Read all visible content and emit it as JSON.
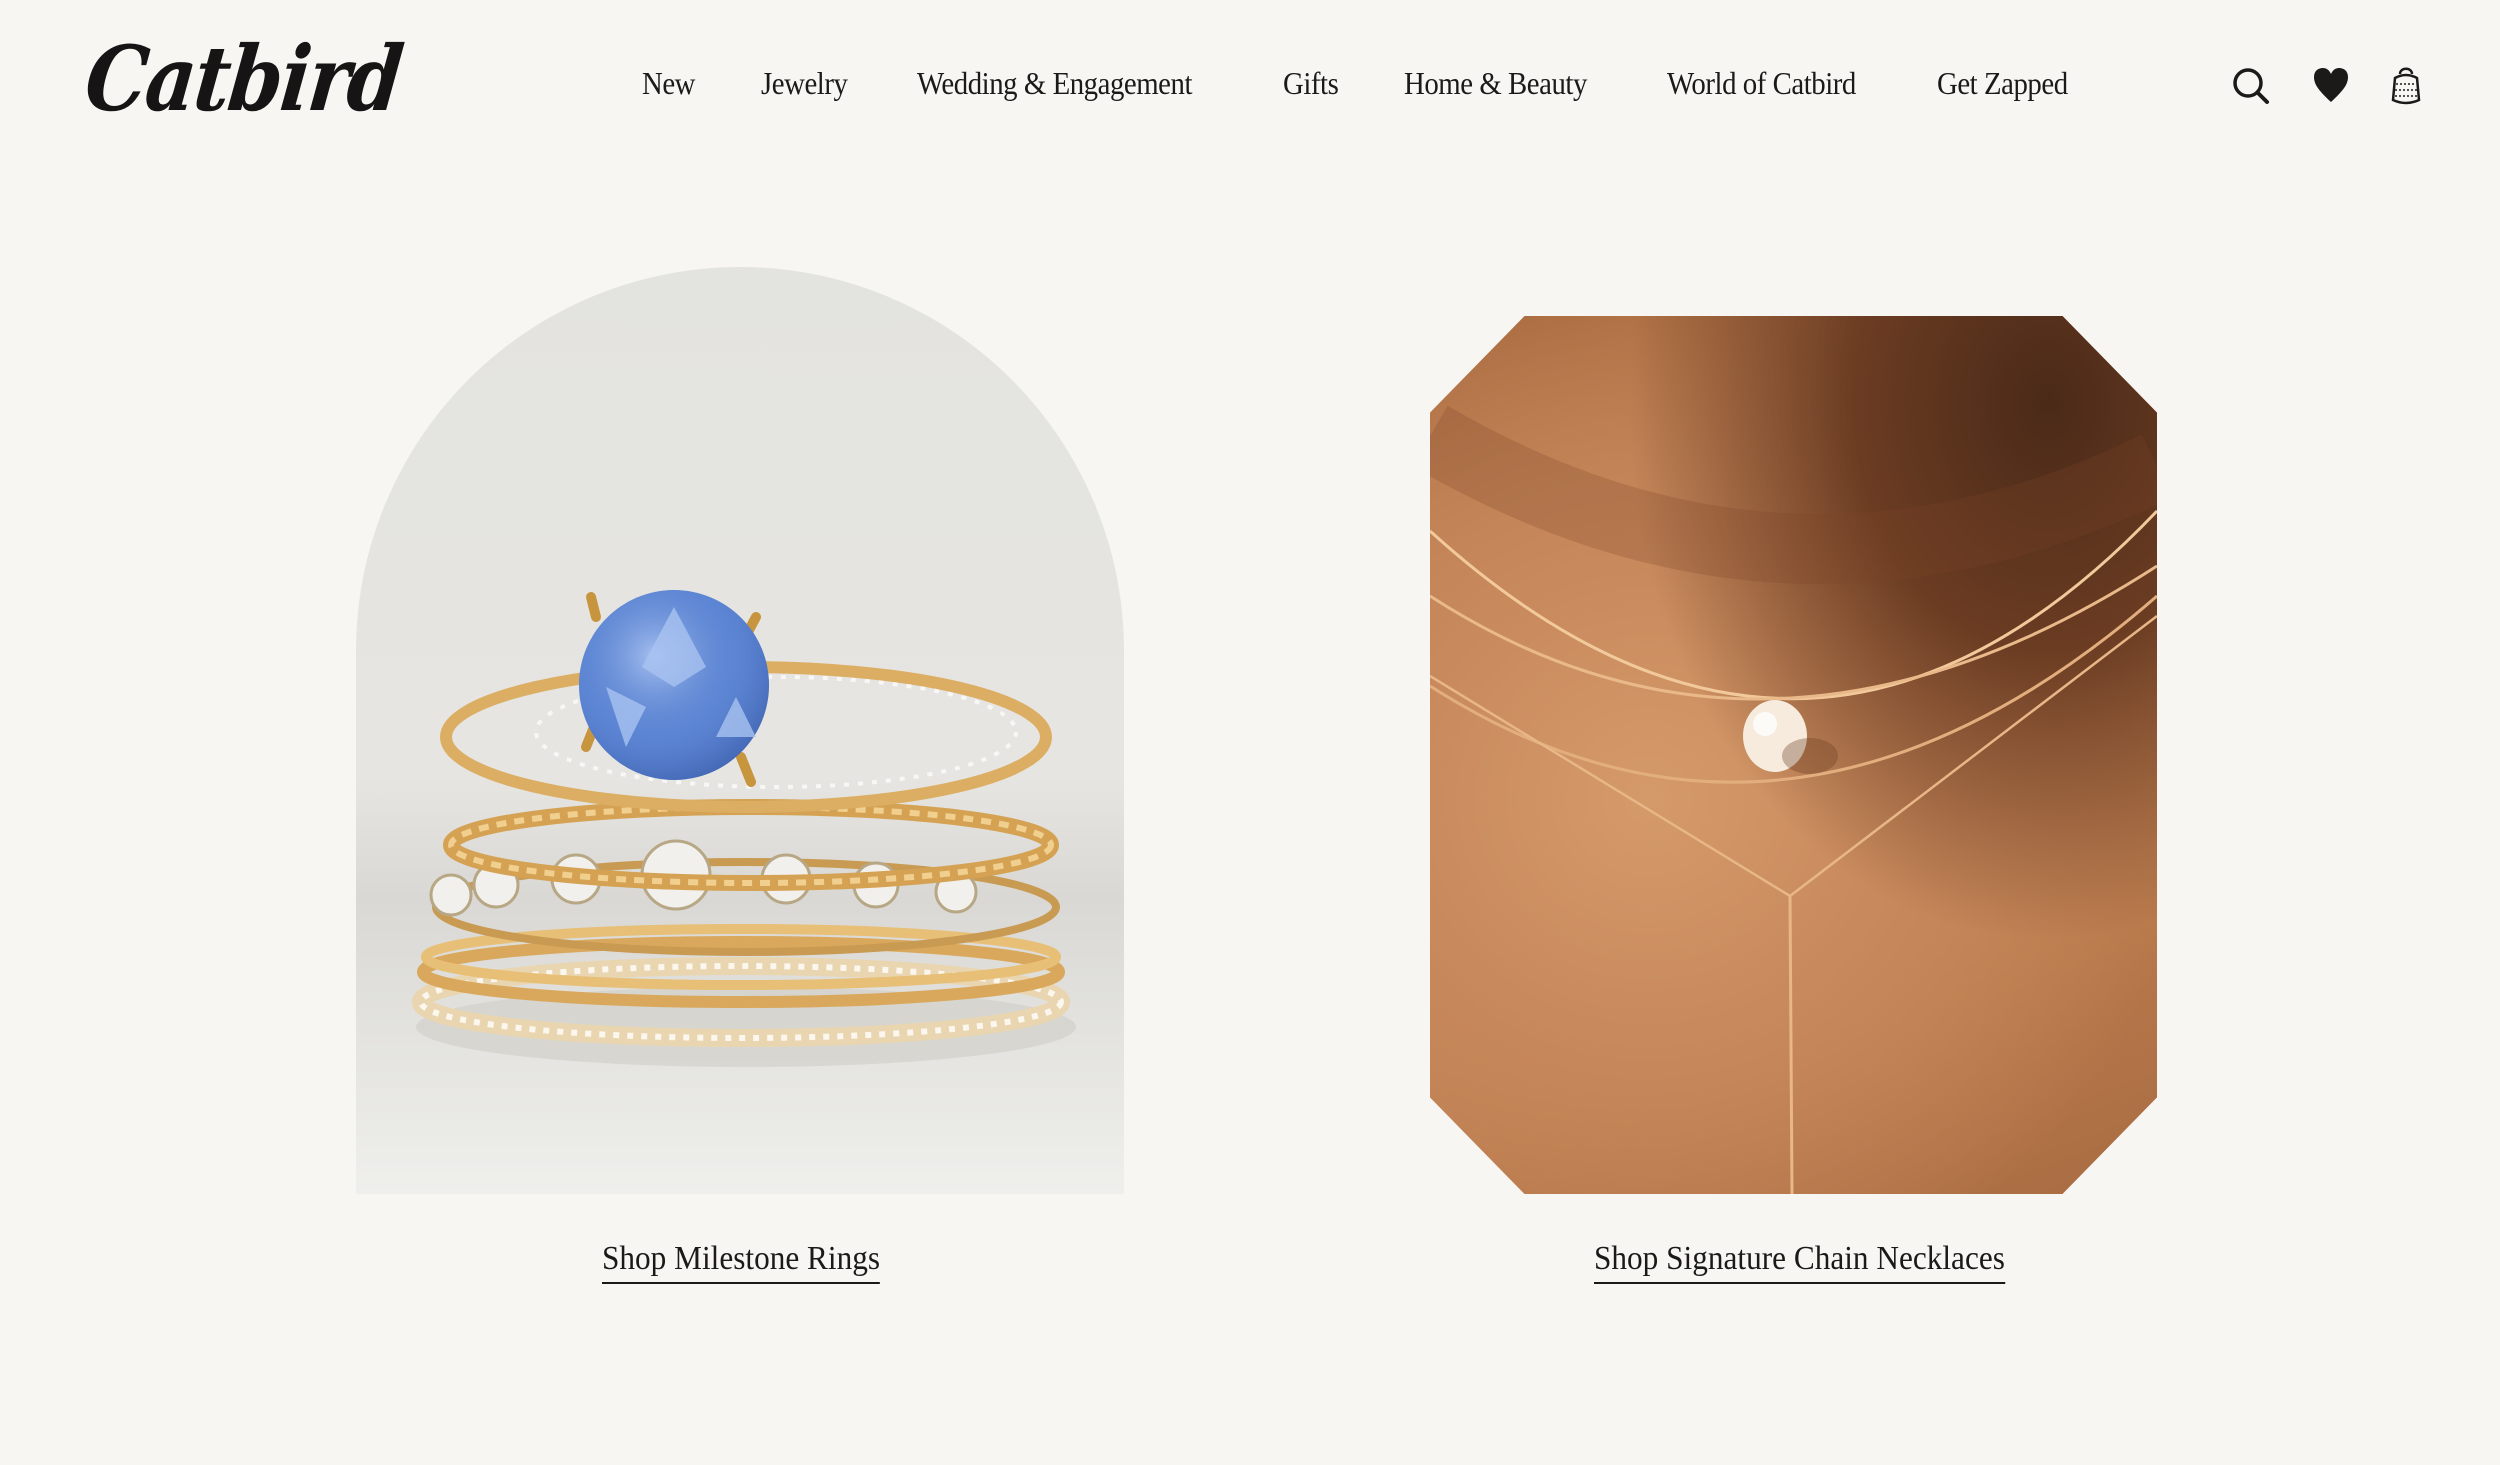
{
  "brand": {
    "logo_text": "Catbird"
  },
  "nav": {
    "items": [
      {
        "label": "New"
      },
      {
        "label": "Jewelry"
      },
      {
        "label": "Wedding & Engagement"
      },
      {
        "label": "Gifts"
      },
      {
        "label": "Home & Beauty"
      },
      {
        "label": "World of Catbird"
      },
      {
        "label": "Get Zapped"
      }
    ]
  },
  "header_icons": {
    "search": "search-icon",
    "wishlist": "heart-icon",
    "bag": "shopping-bag-icon"
  },
  "features": [
    {
      "link_label": "Shop Milestone Rings",
      "image": "stacked-rings-with-blue-sapphire"
    },
    {
      "link_label": "Shop Signature Chain Necklaces",
      "image": "layered-gold-necklaces-with-pearl"
    }
  ],
  "colors": {
    "background": "#f8f6f3",
    "text": "#1c1a19"
  }
}
